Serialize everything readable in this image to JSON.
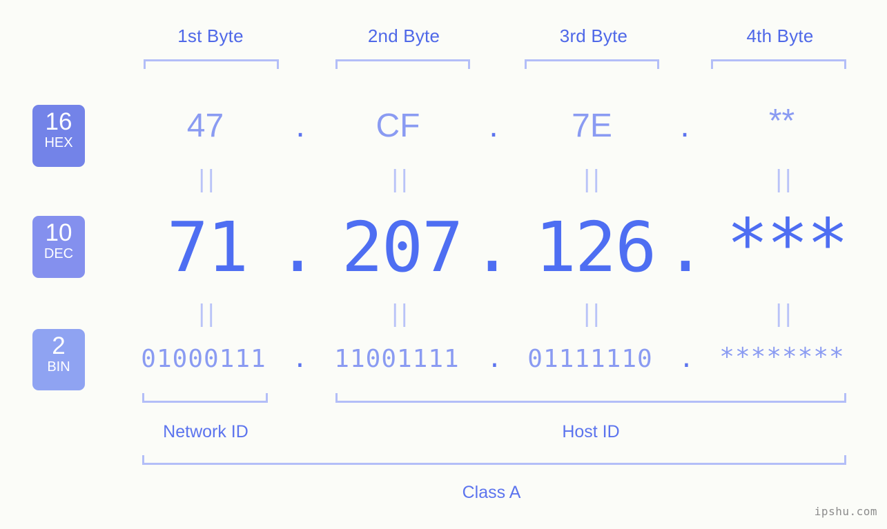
{
  "watermark": "ipshu.com",
  "byte_headers": [
    {
      "label": "1st Byte"
    },
    {
      "label": "2nd Byte"
    },
    {
      "label": "3rd Byte"
    },
    {
      "label": "4th Byte"
    }
  ],
  "bases": [
    {
      "number": "16",
      "name": "HEX",
      "color": "#7383e8"
    },
    {
      "number": "10",
      "name": "DEC",
      "color": "#8490ee"
    },
    {
      "number": "2",
      "name": "BIN",
      "color": "#8fa3f2"
    }
  ],
  "rows": {
    "hex": {
      "values": [
        "47",
        "CF",
        "7E",
        "**"
      ],
      "separator": "."
    },
    "dec": {
      "values": [
        "71",
        "207",
        "126",
        "***"
      ],
      "separator": "."
    },
    "bin": {
      "values": [
        "01000111",
        "11001111",
        "01111110",
        "********"
      ],
      "separator": "."
    }
  },
  "equals_symbol": "||",
  "sections": [
    {
      "label": "Network ID"
    },
    {
      "label": "Host ID"
    }
  ],
  "class_label": "Class A",
  "colors": {
    "background": "#fbfcf8",
    "bracket": "#b3bef8",
    "accent": "#4e6ef2",
    "muted": "#8a9bf2"
  }
}
